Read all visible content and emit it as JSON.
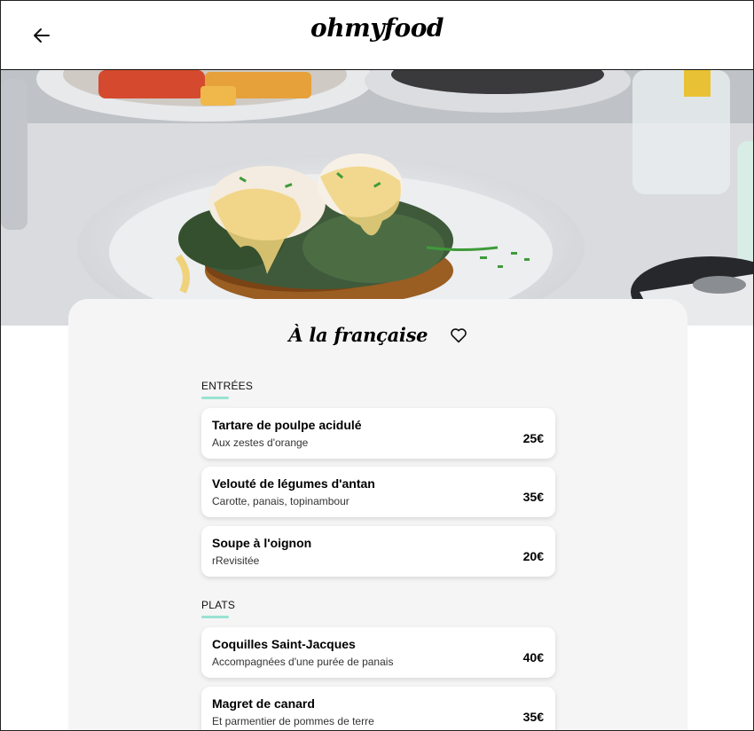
{
  "header": {
    "brand": "ohmyfood",
    "back_icon": "arrow-left-icon"
  },
  "hero": {
    "image": "eggs-benedict-photo"
  },
  "restaurant": {
    "title": "À la française",
    "like_icon": "heart-outline-icon"
  },
  "sections": [
    {
      "label": "ENTRÉES",
      "items": [
        {
          "name": "Tartare de poulpe acidulé",
          "desc": "Aux zestes d'orange",
          "price": "25€"
        },
        {
          "name": "Velouté de légumes d'antan",
          "desc": "Carotte, panais, topinambour",
          "price": "35€"
        },
        {
          "name": "Soupe à l'oignon",
          "desc": "rRevisitée",
          "price": "20€"
        }
      ]
    },
    {
      "label": "PLATS",
      "items": [
        {
          "name": "Coquilles Saint-Jacques",
          "desc": "Accompagnées d'une purée de panais",
          "price": "40€"
        },
        {
          "name": "Magret de canard",
          "desc": "Et parmentier de pommes de terre",
          "price": "35€"
        }
      ]
    }
  ],
  "colors": {
    "accent": "#99e2d0",
    "card_bg": "#f5f5f5"
  }
}
